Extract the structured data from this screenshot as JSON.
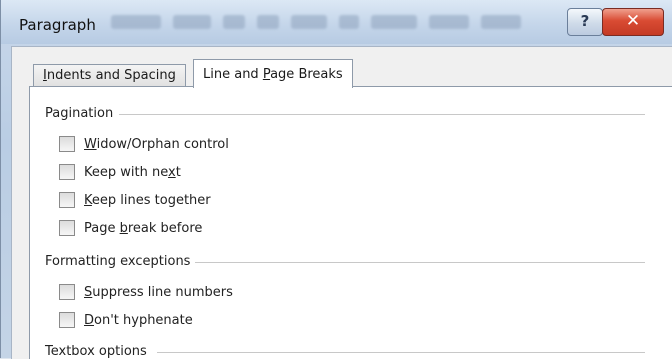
{
  "window": {
    "title": "Paragraph",
    "help_label": "?",
    "close_label": "✕"
  },
  "tabs": [
    {
      "label_pre": "",
      "label_u": "I",
      "label_post": "ndents and Spacing",
      "active": false
    },
    {
      "label_pre": "Line and ",
      "label_u": "P",
      "label_post": "age Breaks",
      "active": true
    }
  ],
  "pagination": {
    "heading": "Pagination",
    "options": [
      {
        "pre": "",
        "u": "W",
        "post": "idow/Orphan control",
        "checked": false
      },
      {
        "pre": "Keep with ne",
        "u": "x",
        "post": "t",
        "checked": false
      },
      {
        "pre": "",
        "u": "K",
        "post": "eep lines together",
        "checked": false
      },
      {
        "pre": "Page ",
        "u": "b",
        "post": "reak before",
        "checked": false
      }
    ]
  },
  "formatting_exceptions": {
    "heading": "Formatting exceptions",
    "options": [
      {
        "pre": "",
        "u": "S",
        "post": "uppress line numbers",
        "checked": false
      },
      {
        "pre": "",
        "u": "D",
        "post": "on't hyphenate",
        "checked": false
      }
    ]
  },
  "textbox_options": {
    "heading": "Textbox options"
  }
}
